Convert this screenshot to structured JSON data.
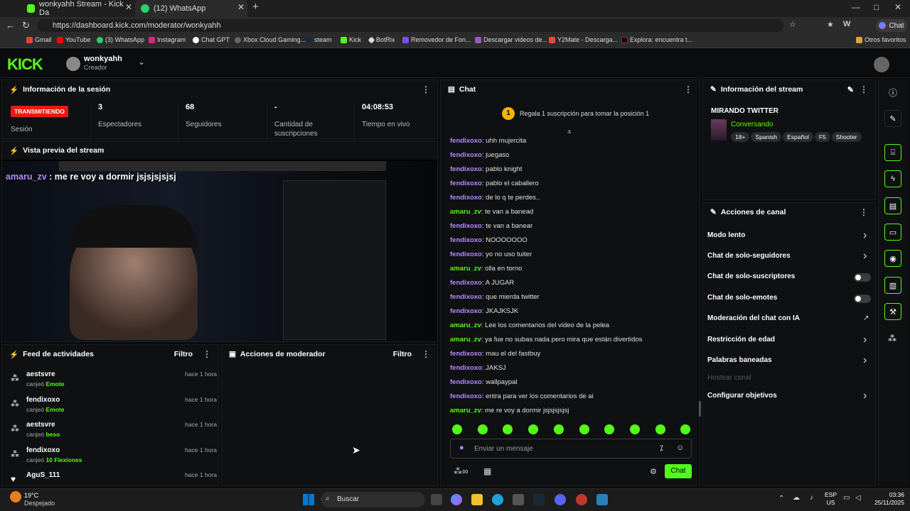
{
  "browser": {
    "tabs": [
      {
        "label": "wonkyahh Stream - Kick Da"
      },
      {
        "label": "(12) WhatsApp"
      }
    ],
    "url": "https://dashboard.kick.com/moderator/wonkyahh",
    "copilot": "Chat",
    "bookmarks": [
      "Gmail",
      "YouTube",
      "(3) WhatsApp",
      "Instagram",
      "Chat GPT",
      "Xbox Cloud Gaming...",
      "steam",
      "Kick",
      "BotRix",
      "Removedor de Fon...",
      "Descargar videos de...",
      "Y2Mate - Descarga...",
      "Explora: encuentra t..."
    ],
    "other_favs": "Otros favoritos"
  },
  "header": {
    "logo": "KICK",
    "user": "wonkyahh",
    "role": "Creador"
  },
  "session": {
    "title": "Información de la sesión",
    "badge": "TRANSMITIENDO",
    "badge_label": "Sesión",
    "stats": [
      {
        "value": "3",
        "label": "Espectadores"
      },
      {
        "value": "68",
        "label": "Seguidores"
      },
      {
        "value": "-",
        "label": "Cantidad de suscripciones"
      },
      {
        "value": "04:08:53",
        "label": "Tiempo en vivo"
      }
    ]
  },
  "preview": {
    "title": "Vista previa del stream",
    "overlay_user": "amaru_zv",
    "overlay_msg": ": me re voy a dormir jsjsjsjsjsj"
  },
  "feed": {
    "title": "Feed de actividades",
    "filter": "Filtro",
    "items": [
      {
        "name": "aestsvre",
        "action": "canjeó",
        "reward": "Emote",
        "time": "hace 1 hora"
      },
      {
        "name": "fendixoxo",
        "action": "canjeó",
        "reward": "Emote",
        "time": "hace 1 hora"
      },
      {
        "name": "aestsvre",
        "action": "canjeó",
        "reward": "beso",
        "time": "hace 1 hora"
      },
      {
        "name": "fendixoxo",
        "action": "canjeó",
        "reward": "10 Flexiones",
        "time": "hace 1 hora"
      },
      {
        "name": "AguS_111",
        "action": "",
        "reward": "",
        "time": "hace 1 hora"
      }
    ]
  },
  "modactions": {
    "title": "Acciones de moderador",
    "filter": "Filtro"
  },
  "chat": {
    "title": "Chat",
    "rank": "1",
    "banner": "Regala 1 suscripción para tomar la posición 1",
    "messages": [
      {
        "user": "fendixoxo",
        "text": "uhh mujercita"
      },
      {
        "user": "fendixoxo",
        "text": "juegaso"
      },
      {
        "user": "fendixoxo",
        "text": "pablo knight"
      },
      {
        "user": "fendixoxo",
        "text": "pablo el caballero"
      },
      {
        "user": "fendixoxo",
        "text": "de lo q te perdes.."
      },
      {
        "user": "amaru_zv",
        "text": "te van a banead"
      },
      {
        "user": "fendixoxo",
        "text": "te van a banear"
      },
      {
        "user": "fendixoxo",
        "text": "NOOOOOOO"
      },
      {
        "user": "fendixoxo",
        "text": "yo no uso tuiter"
      },
      {
        "user": "amaru_zv",
        "text": "olla en torno"
      },
      {
        "user": "fendixoxo",
        "text": "A JUGAR"
      },
      {
        "user": "fendixoxo",
        "text": "que mierda twitter"
      },
      {
        "user": "fendixoxo",
        "text": "JKAJKSJK"
      },
      {
        "user": "amaru_zv",
        "text": "Lee los comentarios del video de la pelea"
      },
      {
        "user": "amaru_zv",
        "text": "ya fue no subas nada pero mira que están divertidos"
      },
      {
        "user": "fendixoxo",
        "text": "mau el del fastbuy"
      },
      {
        "user": "fendixoxo",
        "text": "JAKSJ"
      },
      {
        "user": "fendixoxo",
        "text": "wallpaypal"
      },
      {
        "user": "fendixoxo",
        "text": "entra para ver los comentarios de ai"
      },
      {
        "user": "amaru_zv",
        "text": "me re voy a dormir jsjsjsjsjsj"
      }
    ],
    "placeholder": "Enviar un mensaje",
    "send": "Chat"
  },
  "streaminfo": {
    "title": "Información del stream",
    "stream_title": "MIRANDO TWITTER",
    "category": "Conversando",
    "tags": [
      "18+",
      "Spanish",
      "Español",
      "F5",
      "Shooter"
    ]
  },
  "channel": {
    "title": "Acciones de canal",
    "actions": [
      {
        "label": "Modo lento",
        "ctrl": "chevron"
      },
      {
        "label": "Chat de solo-seguidores",
        "ctrl": "chevron"
      },
      {
        "label": "Chat de solo-suscriptores",
        "ctrl": "toggle"
      },
      {
        "label": "Chat de solo-emotes",
        "ctrl": "toggle"
      },
      {
        "label": "Moderación del chat con IA",
        "ctrl": "external"
      },
      {
        "label": "Restricción de edad",
        "ctrl": "chevron"
      },
      {
        "label": "Palabras baneadas",
        "ctrl": "chevron"
      },
      {
        "label": "Hostear canal",
        "ctrl": "none",
        "disabled": true
      },
      {
        "label": "Configurar objetivos",
        "ctrl": "chevron"
      }
    ]
  },
  "taskbar": {
    "weather_temp": "19°C",
    "weather_desc": "Despejado",
    "search": "Buscar",
    "lang1": "ESP",
    "lang2": "US",
    "time": "03:36",
    "date": "25/11/2025"
  },
  "colors": {
    "accent": "#53fc18",
    "live": "#e91916",
    "bg": "#0b0c0e",
    "panel": "#0f1012"
  }
}
